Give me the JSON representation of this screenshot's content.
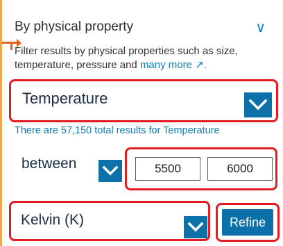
{
  "filter": {
    "section_title": "By physical property",
    "description_prefix": "Filter results by physical properties such as size, temperature, pressure and ",
    "more_link": "many more",
    "more_link_icon": "↗."
  },
  "property_select": {
    "value": "Temperature"
  },
  "results_note": "There are 57,150 total results for Temperature",
  "comparison_select": {
    "value": "between"
  },
  "range": {
    "min": "5500",
    "max": "6000"
  },
  "unit_select": {
    "value": "Kelvin (K)"
  },
  "refine_button": "Refine",
  "colors": {
    "accent_blue": "#0c71a9",
    "highlight_red": "#e31c23",
    "pointer_orange": "#e3621c",
    "panel_border": "#f5a64a"
  }
}
